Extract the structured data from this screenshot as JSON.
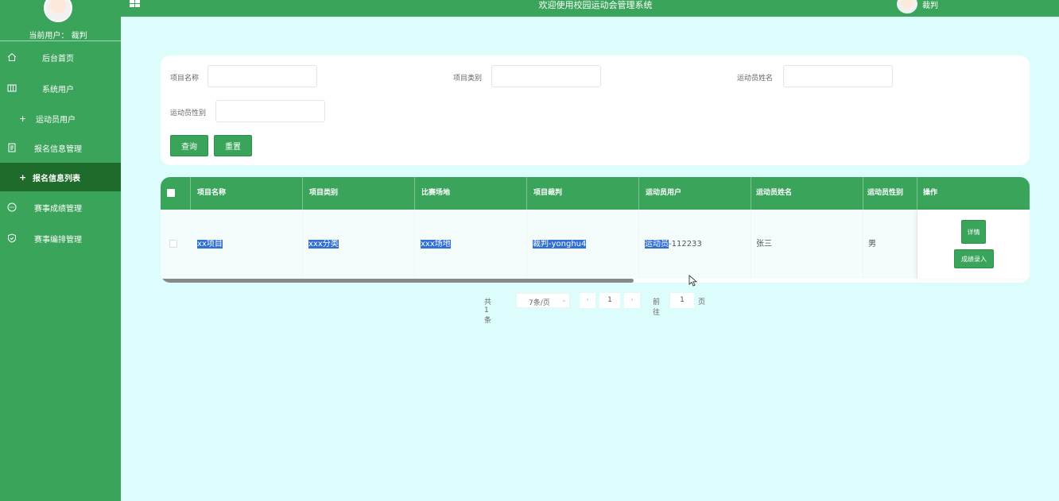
{
  "sidebar": {
    "current_user": "当前用户：  裁判",
    "items": [
      {
        "label": "后台首页",
        "icon": "home-icon"
      },
      {
        "label": "系统用户",
        "icon": "columns-icon"
      },
      {
        "label": "运动员用户",
        "icon": "plus-icon"
      },
      {
        "label": "报名信息管理",
        "icon": "document-icon"
      },
      {
        "label": "报名信息列表",
        "icon": "plus-icon"
      },
      {
        "label": "赛事成绩管理",
        "icon": "chat-icon"
      },
      {
        "label": "赛事编排管理",
        "icon": "shield-icon"
      }
    ]
  },
  "topbar": {
    "title": "欢迎使用校园运动会管理系统",
    "user": "裁判"
  },
  "search": {
    "project_name_label": "项目名称",
    "project_type_label": "项目类别",
    "athlete_name_label": "运动员姓名",
    "athlete_gender_label": "运动员性别",
    "query_button": "查询",
    "reset_button": "重置"
  },
  "table": {
    "headers": [
      "项目名称",
      "项目类别",
      "比赛场地",
      "项目裁判",
      "运动员用户",
      "运动员姓名",
      "运动员性别",
      "操作"
    ],
    "rows": [
      {
        "project_name": "xx项目",
        "project_type": "xxx分类",
        "venue": "xxx场地",
        "referee": "裁判-yonghu4",
        "athlete_user_hl": "运动员",
        "athlete_user_rest": "-112233",
        "athlete_name": "张三",
        "athlete_gender": "男",
        "detail_button": "详情",
        "score_button": "成绩录入"
      }
    ]
  },
  "pagination": {
    "total": "共 1 条",
    "page_size": "7条/页",
    "current_page": "1",
    "goto_label": "前往",
    "goto_value": "1",
    "page_suffix": "页"
  },
  "colors": {
    "primary": "#3aa45b",
    "sidebar_active": "#1f6b2b",
    "background": "#dcfdfb",
    "highlight": "#2f6fd6"
  }
}
